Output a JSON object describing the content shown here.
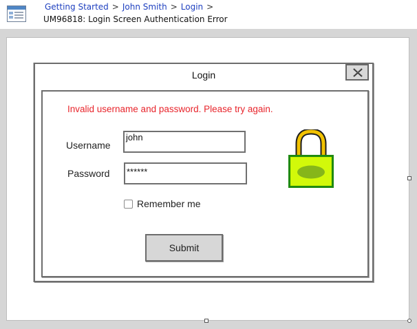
{
  "header": {
    "breadcrumb": [
      "Getting Started",
      "John Smith",
      "Login"
    ],
    "separator": ">",
    "page_title": "UM96818: Login Screen Authentication Error"
  },
  "login_window": {
    "title": "Login",
    "error_message": "Invalid username and password.  Please try again.",
    "username_label": "Username",
    "username_value": "john",
    "password_label": "Password",
    "password_value": "******",
    "remember_label": "Remember me",
    "remember_checked": false,
    "submit_label": "Submit"
  },
  "icons": {
    "page": "page-layout-icon",
    "close": "close-x-icon",
    "lock": "padlock-icon"
  },
  "colors": {
    "error": "#e8242b",
    "link": "#1d3fbf",
    "lock_body": "#c8f000",
    "lock_shackle": "#f2c200"
  }
}
